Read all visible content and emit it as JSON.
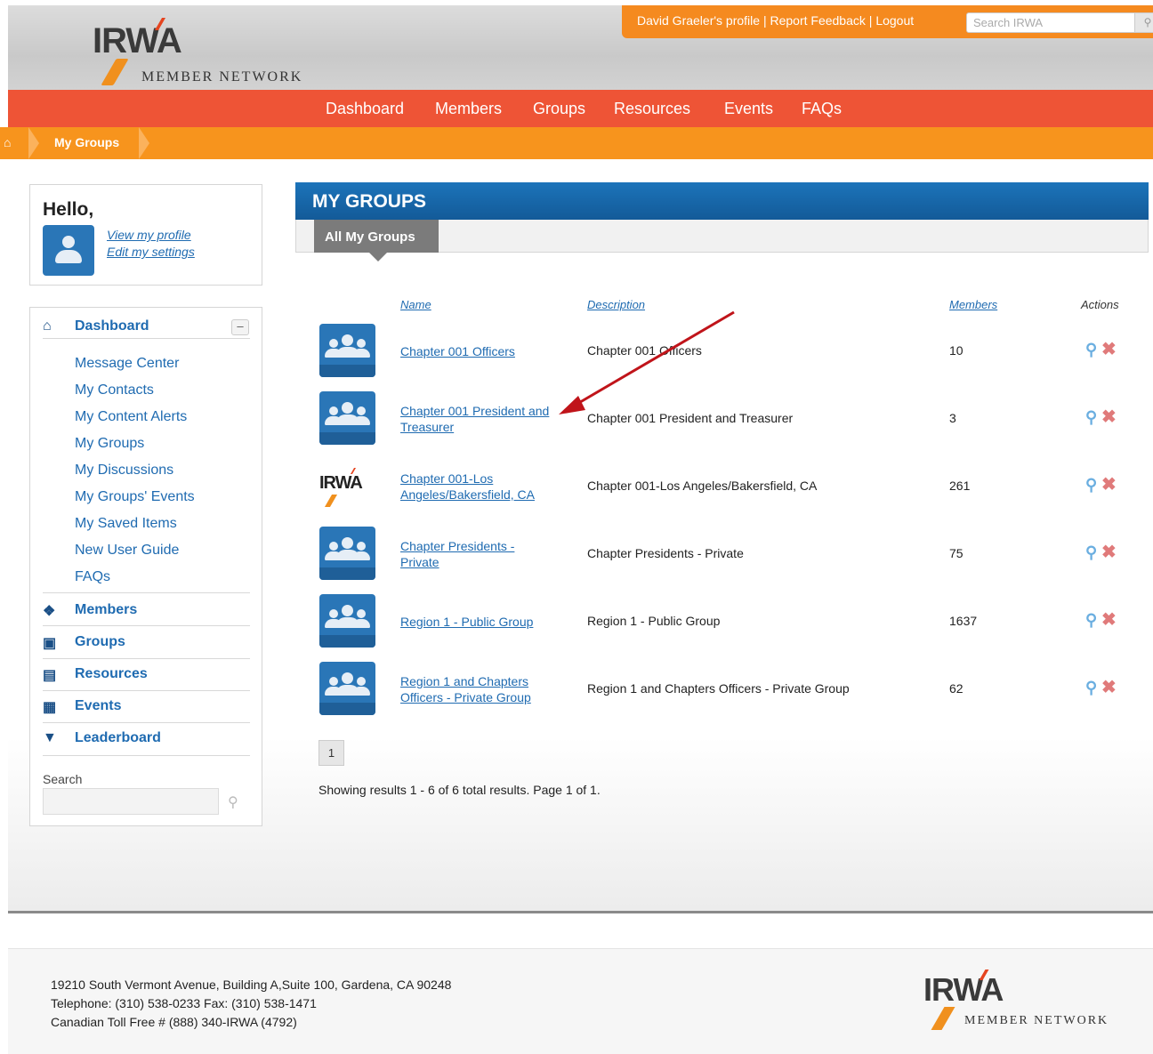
{
  "brand": {
    "logo_text": "IRWA",
    "logo_subtitle": "MEMBER NETWORK"
  },
  "userbar": {
    "profile_link": "David Graeler's profile",
    "feedback_link": "Report Feedback",
    "logout_link": "Logout",
    "separator": " | ",
    "search_placeholder": "Search IRWA"
  },
  "main_nav": [
    "Dashboard",
    "Members",
    "Groups",
    "Resources",
    "Events",
    "FAQs"
  ],
  "breadcrumb": {
    "current": "My Groups"
  },
  "sidebar": {
    "greeting": "Hello,",
    "view_profile": "View my profile",
    "edit_settings": "Edit my settings",
    "dashboard": {
      "label": "Dashboard",
      "collapse_symbol": "–",
      "items": [
        "Message Center",
        "My Contacts",
        "My Content Alerts",
        "My Groups",
        "My Discussions",
        "My Groups' Events",
        "My Saved Items",
        "New User Guide",
        "FAQs"
      ]
    },
    "sections": [
      "Members",
      "Groups",
      "Resources",
      "Events",
      "Leaderboard"
    ],
    "search_label": "Search"
  },
  "panel": {
    "title": "MY GROUPS",
    "tab": "All My Groups",
    "columns": {
      "name": "Name",
      "description": "Description",
      "members": "Members",
      "actions": "Actions"
    },
    "groups": [
      {
        "name_line1": "Chapter 001 Officers",
        "name_line2": "",
        "description": "Chapter 001 Officers",
        "members": "10",
        "icon": "group-icon"
      },
      {
        "name_line1": "Chapter 001 President and",
        "name_line2": "Treasurer",
        "description": "Chapter 001 President and Treasurer",
        "members": "3",
        "icon": "group-icon"
      },
      {
        "name_line1": "Chapter 001-Los",
        "name_line2": "Angeles/Bakersfield, CA",
        "description": "Chapter 001-Los Angeles/Bakersfield, CA",
        "members": "261",
        "icon": "irwa-logo-icon"
      },
      {
        "name_line1": "Chapter Presidents -",
        "name_line2": "Private",
        "description": "Chapter Presidents - Private",
        "members": "75",
        "icon": "group-icon"
      },
      {
        "name_line1": "Region 1 - Public Group",
        "name_line2": "",
        "description": "Region 1 - Public Group",
        "members": "1637",
        "icon": "group-icon"
      },
      {
        "name_line1": "Region 1 and Chapters",
        "name_line2": "Officers - Private Group",
        "description": "Region 1 and Chapters Officers - Private Group",
        "members": "62",
        "icon": "group-icon"
      }
    ],
    "page_number": "1",
    "results_text": "Showing results 1 - 6 of 6 total results. Page 1 of 1."
  },
  "footer": {
    "address": "19210 South Vermont Avenue, Building A,Suite 100, Gardena, CA 90248",
    "phone": "Telephone: (310) 538-0233 Fax: (310) 538-1471",
    "tollfree": "Canadian Toll Free # (888) 340-IRWA (4792)"
  },
  "colors": {
    "orange": "#f58a1f",
    "red_nav": "#ee5436",
    "blue_header": "#1c74ba",
    "link_blue": "#1f6bb1",
    "annotation_arrow": "#c0141a"
  }
}
